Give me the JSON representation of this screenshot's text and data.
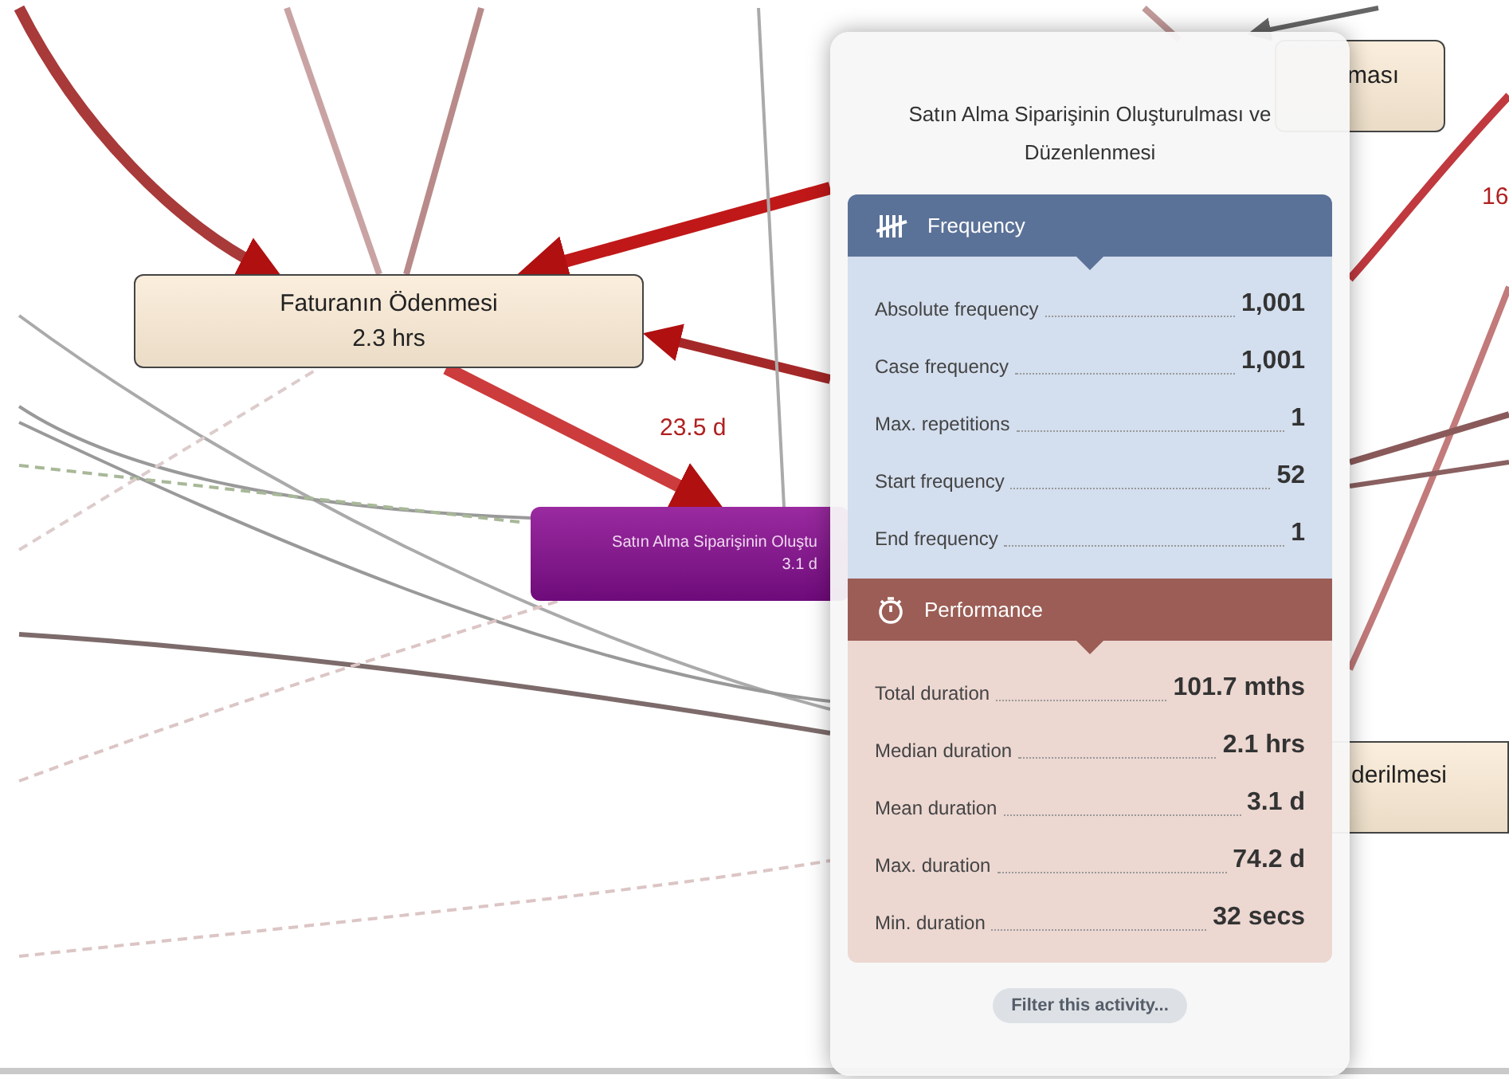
{
  "map": {
    "nodes": [
      {
        "kind": "activity",
        "label": "Faturanın Ödenmesi",
        "duration": "2.3 hrs"
      },
      {
        "kind": "selected",
        "label": "Satın Alma Siparişinin Oluştu",
        "duration": "3.1 d"
      },
      {
        "kind": "partial-top",
        "label": "ması"
      },
      {
        "kind": "partial-bottom",
        "label": "derilmesi"
      }
    ],
    "edge_labels": [
      "23.5 d",
      "16"
    ]
  },
  "popup": {
    "title": "Satın Alma Siparişinin Oluşturulması ve Düzenlenmesi",
    "sections": [
      {
        "kind": "frequency",
        "title": "Frequency",
        "rows": [
          {
            "label": "Absolute frequency",
            "value": "1,001"
          },
          {
            "label": "Case frequency",
            "value": "1,001"
          },
          {
            "label": "Max. repetitions",
            "value": "1"
          },
          {
            "label": "Start frequency",
            "value": "52"
          },
          {
            "label": "End frequency",
            "value": "1"
          }
        ]
      },
      {
        "kind": "performance",
        "title": "Performance",
        "rows": [
          {
            "label": "Total duration",
            "value": "101.7 mths"
          },
          {
            "label": "Median duration",
            "value": "2.1 hrs"
          },
          {
            "label": "Mean duration",
            "value": "3.1 d"
          },
          {
            "label": "Max. duration",
            "value": "74.2 d"
          },
          {
            "label": "Min. duration",
            "value": "32 secs"
          }
        ]
      }
    ],
    "button": "Filter this activity..."
  }
}
